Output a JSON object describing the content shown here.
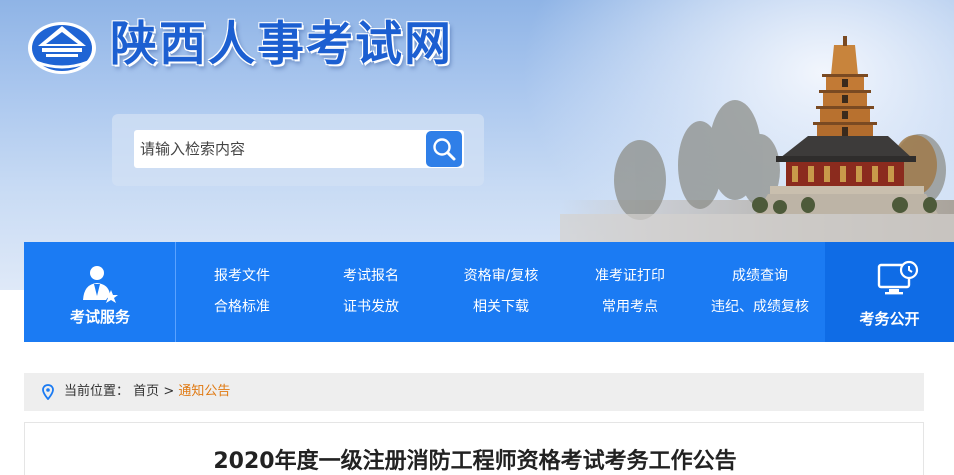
{
  "site": {
    "title": "陕西人事考试网"
  },
  "search": {
    "placeholder": "请输入检索内容",
    "value": ""
  },
  "nav": {
    "left_label": "考试服务",
    "right_label": "考务公开",
    "links": [
      [
        "报考文件",
        "考试报名",
        "资格审/复核",
        "准考证打印",
        "成绩查询"
      ],
      [
        "合格标准",
        "证书发放",
        "相关下载",
        "常用考点",
        "违纪、成绩复核"
      ]
    ]
  },
  "breadcrumb": {
    "prefix": "当前位置：",
    "home": "首页",
    "separator": ">",
    "current": "通知公告"
  },
  "article": {
    "title": "2020年度一级注册消防工程师资格考试考务工作公告"
  },
  "colors": {
    "brand_blue": "#1b7bf3",
    "nav_dark": "#0f6ce6",
    "title_blue": "#1c5fd1",
    "crumb_active": "#e07a13"
  }
}
